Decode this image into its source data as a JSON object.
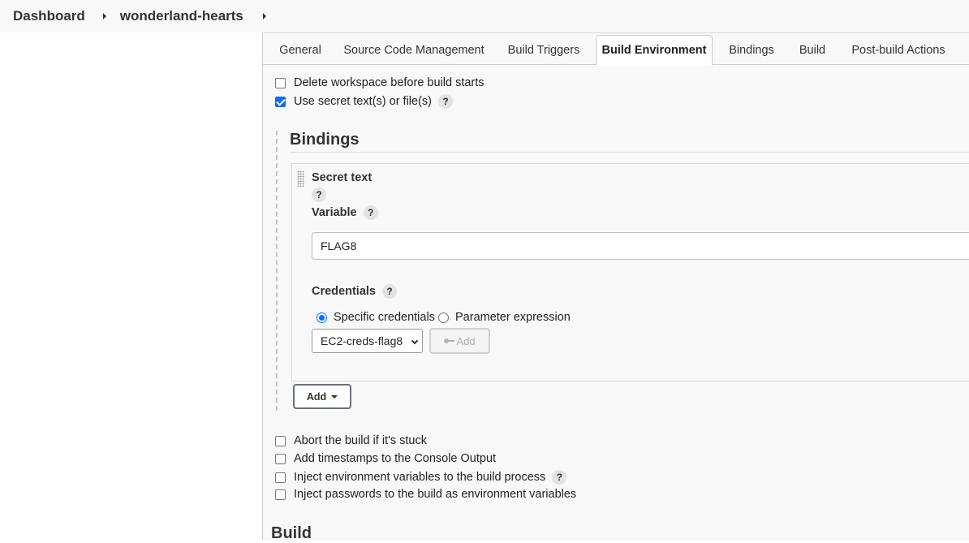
{
  "breadcrumb": {
    "items": [
      "Dashboard",
      "wonderland-hearts"
    ]
  },
  "tabs": [
    {
      "label": "General",
      "active": false
    },
    {
      "label": "Source Code Management",
      "active": false
    },
    {
      "label": "Build Triggers",
      "active": false
    },
    {
      "label": "Build Environment",
      "active": true
    },
    {
      "label": "Bindings",
      "active": false
    },
    {
      "label": "Build",
      "active": false
    },
    {
      "label": "Post-build Actions",
      "active": false
    }
  ],
  "build_env": {
    "delete_workspace": {
      "label": "Delete workspace before build starts",
      "checked": false
    },
    "use_secret": {
      "label": "Use secret text(s) or file(s)",
      "checked": true
    }
  },
  "bindings": {
    "title": "Bindings",
    "binding": {
      "type_label": "Secret text",
      "variable_label": "Variable",
      "variable_value": "FLAG8",
      "credentials_label": "Credentials",
      "radio_specific": {
        "label": "Specific credentials",
        "checked": true
      },
      "radio_param": {
        "label": "Parameter expression",
        "checked": false
      },
      "selected_credential": "EC2-creds-flag8",
      "add_credential_label": "Add"
    },
    "add_button_label": "Add"
  },
  "more_options": [
    {
      "label": "Abort the build if it's stuck",
      "checked": false,
      "help": false
    },
    {
      "label": "Add timestamps to the Console Output",
      "checked": false,
      "help": false
    },
    {
      "label": "Inject environment variables to the build process",
      "checked": false,
      "help": true
    },
    {
      "label": "Inject passwords to the build as environment variables",
      "checked": false,
      "help": false
    }
  ],
  "help_glyph": "?",
  "build_heading": "Build",
  "colors": {
    "accent": "#0b6cff",
    "panel_bg": "#f8f8f8",
    "border": "#cccccc"
  }
}
